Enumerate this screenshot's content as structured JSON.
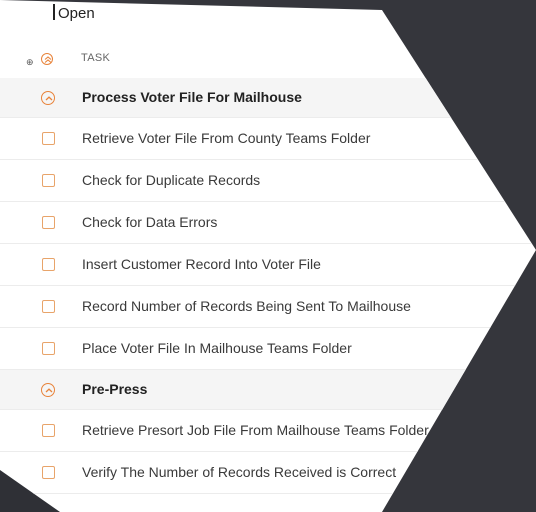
{
  "section": {
    "title": "Open"
  },
  "header": {
    "task_label": "TASK"
  },
  "groups": [
    {
      "name": "Process Voter File For Mailhouse",
      "tasks": [
        "Retrieve Voter File From County Teams Folder",
        "Check for Duplicate Records",
        "Check for Data Errors",
        "Insert Customer Record Into Voter File",
        "Record Number of Records Being Sent To Mailhouse",
        "Place Voter File In Mailhouse Teams Folder"
      ]
    },
    {
      "name": "Pre-Press",
      "tasks": [
        "Retrieve Presort Job File From Mailhouse Teams Folder",
        "Verify The Number of Records Received is Correct"
      ]
    }
  ],
  "colors": {
    "accent": "#e8833a",
    "background": "#35363c",
    "card": "#ffffff"
  }
}
